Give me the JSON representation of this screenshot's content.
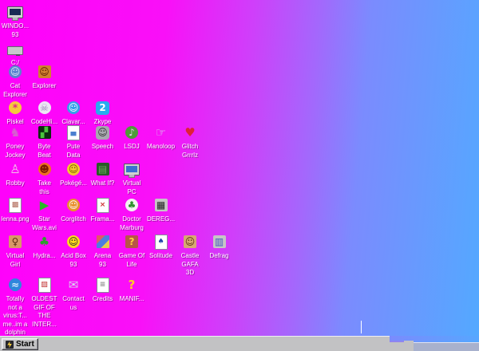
{
  "desktop": {
    "gradient": {
      "left": "#ff00fa",
      "left_hold": "#f910f8",
      "mid": "#cf3ffa",
      "purple": "#a368fc",
      "blue_start": "#7b8bfe",
      "right": "#53a9ff"
    },
    "icons": [
      {
        "name": "shortcut-windows93",
        "icon": "computer-monitor-icon",
        "label": "WINDO...\n93",
        "shape": "monitor",
        "bg": "",
        "fg": "#1a2a55",
        "glyph": "",
        "col": 0,
        "row": 0
      },
      {
        "name": "shortcut-c-drive",
        "icon": "hard-drive-icon",
        "label": "C:/",
        "shape": "drive",
        "bg": "",
        "fg": "#555555",
        "glyph": "",
        "col": 0,
        "row": 1
      },
      {
        "name": "shortcut-cat-explorer",
        "icon": "cat-icon",
        "label": "Cat\nExplorer",
        "shape": "circle",
        "bg": "#5b83cf",
        "fg": "#dce6f8",
        "glyph": "☺",
        "col": 0,
        "row": 2
      },
      {
        "name": "shortcut-explorer",
        "icon": "explorer-face-icon",
        "label": "Explorer",
        "shape": "square",
        "bg": "#d08030",
        "fg": "#5a1600",
        "glyph": "☺",
        "col": 1,
        "row": 2
      },
      {
        "name": "shortcut-piskel",
        "icon": "paint-palette-icon",
        "label": "Piskel",
        "shape": "circle",
        "bg": "#f5c93e",
        "fg": "#e0218a",
        "glyph": "*",
        "col": 0,
        "row": 3
      },
      {
        "name": "shortcut-codehi",
        "icon": "skull-icon",
        "label": "CodeHi...",
        "shape": "circle",
        "bg": "#ece6f4",
        "fg": "#9b84b8",
        "glyph": "☠",
        "col": 1,
        "row": 3
      },
      {
        "name": "shortcut-clavar",
        "icon": "chat-face-icon",
        "label": "Clavar...",
        "shape": "circle",
        "bg": "#35a0ea",
        "fg": "#ffffff",
        "glyph": "☺",
        "col": 2,
        "row": 3
      },
      {
        "name": "shortcut-zkype",
        "icon": "zkype-logo-icon",
        "label": "Zkype",
        "shape": "rounded",
        "bg": "#29abee",
        "fg": "#ffffff",
        "glyph": "2",
        "col": 3,
        "row": 3
      },
      {
        "name": "shortcut-poney-jockey",
        "icon": "pony-icon",
        "label": "Poney\nJockey",
        "shape": "none",
        "bg": "",
        "fg": "#d65fd0",
        "glyph": "♞",
        "col": 0,
        "row": 4
      },
      {
        "name": "shortcut-byte-beat",
        "icon": "waveform-icon",
        "label": "Byte\nBeat",
        "shape": "square",
        "bg": "#0e2c10",
        "fg": "#49c43c",
        "glyph": "▞",
        "col": 1,
        "row": 4
      },
      {
        "name": "shortcut-pute-data",
        "icon": "data-document-icon",
        "label": "Pute\nData",
        "shape": "doc",
        "bg": "",
        "fg": "#4a7fd0",
        "glyph": "▄",
        "col": 2,
        "row": 4
      },
      {
        "name": "shortcut-speech",
        "icon": "speech-face-icon",
        "label": "Speech",
        "shape": "rounded",
        "bg": "#a8a8b0",
        "fg": "#333333",
        "glyph": "☺",
        "col": 3,
        "row": 4
      },
      {
        "name": "shortcut-lsdj",
        "icon": "music-note-icon",
        "label": "LSDJ",
        "shape": "circle",
        "bg": "#4f9a3a",
        "fg": "#e8d0f0",
        "glyph": "♪",
        "col": 4,
        "row": 4
      },
      {
        "name": "shortcut-manoloop",
        "icon": "hand-icon",
        "label": "Manoloop",
        "shape": "none",
        "bg": "",
        "fg": "#d3d4ea",
        "glyph": "☞",
        "col": 5,
        "row": 4
      },
      {
        "name": "shortcut-glitch-grrrlz",
        "icon": "lips-heart-icon",
        "label": "Glitch\nGrrrlz",
        "shape": "none",
        "bg": "",
        "fg": "#e02038",
        "glyph": "♥",
        "col": 6,
        "row": 4
      },
      {
        "name": "shortcut-robby",
        "icon": "robot-icon",
        "label": "Robby",
        "shape": "none",
        "bg": "",
        "fg": "#f0c8e8",
        "glyph": "♙",
        "col": 0,
        "row": 5
      },
      {
        "name": "shortcut-take-this",
        "icon": "wizard-icon",
        "label": "Take\nthis",
        "shape": "circle",
        "bg": "#ee7024",
        "fg": "#7a1800",
        "glyph": "☻",
        "col": 1,
        "row": 5
      },
      {
        "name": "shortcut-pokege",
        "icon": "yellow-smiley-icon",
        "label": "Pokégé...",
        "shape": "circle",
        "bg": "#f4c82e",
        "fg": "#7a5800",
        "glyph": "☺",
        "col": 2,
        "row": 5
      },
      {
        "name": "shortcut-what-if",
        "icon": "green-window-icon",
        "label": "What If?",
        "shape": "square",
        "bg": "#2a5a28",
        "fg": "#6fae5f",
        "glyph": "▤",
        "col": 3,
        "row": 5
      },
      {
        "name": "shortcut-virtual-pc",
        "icon": "virtual-pc-monitor-icon",
        "label": "Virtual\nPC",
        "shape": "monitor",
        "bg": "",
        "fg": "#3a6fd0",
        "glyph": "",
        "col": 4,
        "row": 5
      },
      {
        "name": "shortcut-lenna-png",
        "icon": "image-file-icon",
        "label": "lenna.png",
        "shape": "doc",
        "bg": "",
        "fg": "#b06858",
        "glyph": "▩",
        "col": 0,
        "row": 6
      },
      {
        "name": "shortcut-star-wars-avi",
        "icon": "play-video-icon",
        "label": "Star\nWars.avi",
        "shape": "none",
        "bg": "",
        "fg": "#27b827",
        "glyph": "▶",
        "col": 1,
        "row": 6
      },
      {
        "name": "shortcut-corglitch",
        "icon": "corgi-dog-icon",
        "label": "Corglitch",
        "shape": "circle",
        "bg": "#e89030",
        "fg": "#ffffff",
        "glyph": "☺",
        "col": 2,
        "row": 6
      },
      {
        "name": "shortcut-frama",
        "icon": "document-x-icon",
        "label": "Frama...",
        "shape": "doc",
        "bg": "",
        "fg": "#cc3333",
        "glyph": "×",
        "col": 3,
        "row": 6
      },
      {
        "name": "shortcut-doctor-marburg",
        "icon": "plant-pot-icon",
        "label": "Doctor\nMarburg",
        "shape": "circle",
        "bg": "#f2f2f2",
        "fg": "#2f8f2f",
        "glyph": "♣",
        "col": 4,
        "row": 6
      },
      {
        "name": "shortcut-dereg",
        "icon": "qr-window-icon",
        "label": "DEREG...",
        "shape": "square",
        "bg": "#c6c6c6",
        "fg": "#222222",
        "glyph": "▦",
        "col": 5,
        "row": 6
      },
      {
        "name": "shortcut-virtual-girl",
        "icon": "pixel-woman-icon",
        "label": "Virtual\nGirl",
        "shape": "square",
        "bg": "#d89868",
        "fg": "#5a2a10",
        "glyph": "♀",
        "col": 0,
        "row": 7
      },
      {
        "name": "shortcut-hydra",
        "icon": "dragon-icon",
        "label": "Hydra...",
        "shape": "none",
        "bg": "",
        "fg": "#2f9e2f",
        "glyph": "♣",
        "col": 1,
        "row": 7
      },
      {
        "name": "shortcut-acid-box-93",
        "icon": "acid-smiley-icon",
        "label": "Acid Box\n93",
        "shape": "circle",
        "bg": "#ffd81e",
        "fg": "#2a2a2a",
        "glyph": "☺",
        "col": 2,
        "row": 7
      },
      {
        "name": "shortcut-arena-93",
        "icon": "color-cube-icon",
        "label": "Arena\n93",
        "shape": "cube",
        "bg": "linear-gradient(135deg,#e05868 0 34%,#4d7de0 34% 67%,#e8cc4d 67% 100%)",
        "fg": "",
        "glyph": "",
        "col": 3,
        "row": 7
      },
      {
        "name": "shortcut-game-of-life",
        "icon": "question-sprite-icon",
        "label": "Game Of\nLife",
        "shape": "square",
        "bg": "#b85548",
        "fg": "#ffd23f",
        "glyph": "?",
        "col": 4,
        "row": 7
      },
      {
        "name": "shortcut-solitude",
        "icon": "playing-card-icon",
        "label": "Solitude",
        "shape": "doc",
        "bg": "",
        "fg": "#2244aa",
        "glyph": "♠",
        "col": 5,
        "row": 7
      },
      {
        "name": "shortcut-castle-gafa-3d",
        "icon": "face-portrait-icon",
        "label": "Castle\nGAFA\n3D",
        "shape": "square",
        "bg": "#d8a872",
        "fg": "#5a2f10",
        "glyph": "☺",
        "col": 6,
        "row": 7
      },
      {
        "name": "shortcut-defrag",
        "icon": "defrag-blocks-icon",
        "label": "Defrag",
        "shape": "square",
        "bg": "#c6c6c6",
        "fg": "#4055c0",
        "glyph": "▥",
        "col": 7,
        "row": 7
      },
      {
        "name": "shortcut-not-a-virus",
        "icon": "dolphin-icon",
        "label": "Totally\nnot a\nvirus:T...\nme..im a\ndolphin",
        "shape": "circle",
        "bg": "#2f86dc",
        "fg": "#d8ecff",
        "glyph": "≈",
        "col": 0,
        "row": 8
      },
      {
        "name": "shortcut-oldest-gif",
        "icon": "gif-file-icon",
        "label": "OLDEST\nGIF OF\nTHE\nINTER...",
        "shape": "doc",
        "bg": "",
        "fg": "#c03030",
        "glyph": "▨",
        "col": 1,
        "row": 8
      },
      {
        "name": "shortcut-contact-us",
        "icon": "envelope-icon",
        "label": "Contact\nus",
        "shape": "none",
        "bg": "",
        "fg": "#d8d8f0",
        "glyph": "✉",
        "col": 2,
        "row": 8
      },
      {
        "name": "shortcut-credits",
        "icon": "text-document-icon",
        "label": "Credits",
        "shape": "doc",
        "bg": "",
        "fg": "#888888",
        "glyph": "≡",
        "col": 3,
        "row": 8
      },
      {
        "name": "shortcut-manifesto",
        "icon": "question-mark-icon",
        "label": "MANIF...",
        "shape": "none",
        "bg": "",
        "fg": "#ffcc22",
        "glyph": "?",
        "col": 4,
        "row": 8
      }
    ]
  },
  "taskbar": {
    "start_label": "Start",
    "bar_color": "#c2c2c4",
    "start_logo_bg": "#26262c",
    "start_logo_bolt": "#ffd23f"
  }
}
